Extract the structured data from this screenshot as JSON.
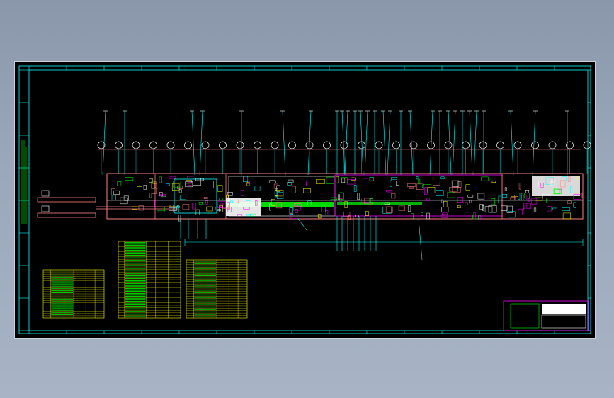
{
  "colors": {
    "background": "#000000",
    "frame": "#00ffff",
    "main_structure": "#ff8080",
    "equipment": "#ffffff",
    "conveyor": "#00ff00",
    "leaders": "#00ffff",
    "table_grid": "#ffff00",
    "table_fill": "#00ff00",
    "title_block": "#ff00ff"
  },
  "drawing": {
    "type": "CAD layout drawing",
    "title_block": {
      "logo_label": "",
      "rows": []
    }
  }
}
